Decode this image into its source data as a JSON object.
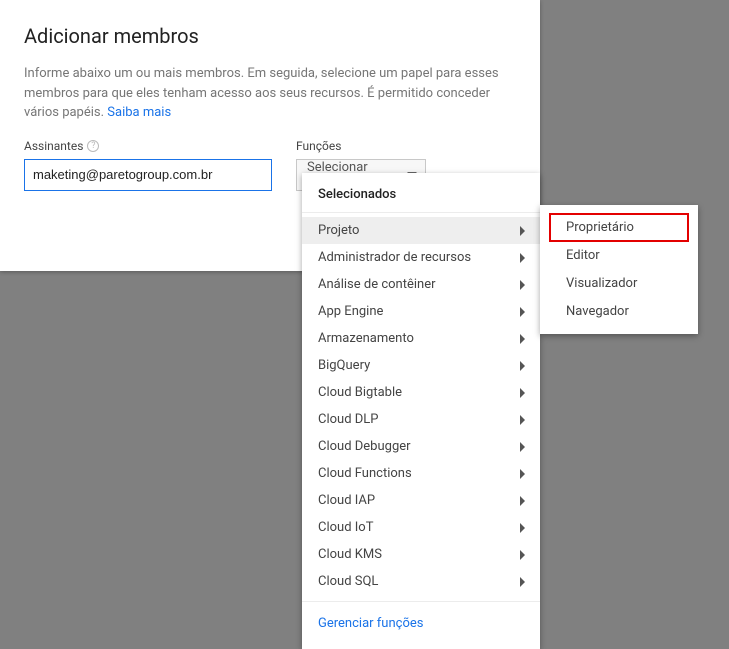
{
  "dialog": {
    "title": "Adicionar membros",
    "description": "Informe abaixo um ou mais membros. Em seguida, selecione um papel para esses membros para que eles tenham acesso aos seus recursos. É permitido conceder vários papéis. ",
    "learn_more": "Saiba mais"
  },
  "fields": {
    "subscribers_label": "Assinantes",
    "subscribers_value": "maketing@paretogroup.com.br",
    "roles_label": "Funções",
    "role_placeholder": "Selecionar papel"
  },
  "menu": {
    "header": "Selecionados",
    "items": [
      "Projeto",
      "Administrador de recursos",
      "Análise de contêiner",
      "App Engine",
      "Armazenamento",
      "BigQuery",
      "Cloud Bigtable",
      "Cloud DLP",
      "Cloud Debugger",
      "Cloud Functions",
      "Cloud IAP",
      "Cloud IoT",
      "Cloud KMS",
      "Cloud SQL"
    ],
    "hover_index": 0,
    "footer": "Gerenciar funções"
  },
  "submenu": {
    "items": [
      "Proprietário",
      "Editor",
      "Visualizador",
      "Navegador"
    ],
    "highlight_index": 0
  }
}
